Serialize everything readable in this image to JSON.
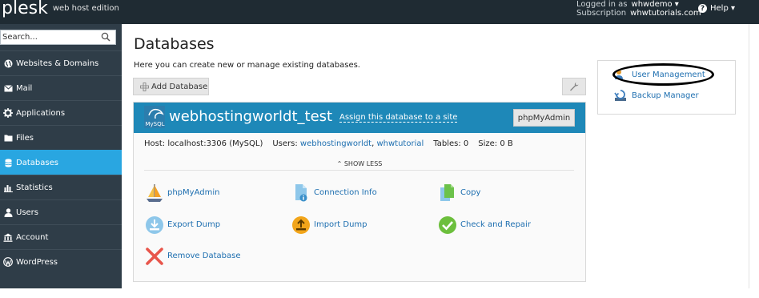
{
  "brand": {
    "logo": "plesk",
    "edition": "web host edition"
  },
  "account": {
    "logged_in_label": "Logged in as",
    "user": "whwdemo ▾",
    "subscription_label": "Subscription",
    "subscription": "whwtutorials.com"
  },
  "help": {
    "label": "Help ▾"
  },
  "search": {
    "placeholder": "Search..."
  },
  "nav": [
    {
      "label": "Websites & Domains",
      "icon": "globe-icon"
    },
    {
      "label": "Mail",
      "icon": "mail-icon"
    },
    {
      "label": "Applications",
      "icon": "gear-icon"
    },
    {
      "label": "Files",
      "icon": "folder-icon"
    },
    {
      "label": "Databases",
      "icon": "database-icon",
      "active": true
    },
    {
      "label": "Statistics",
      "icon": "bar-chart-icon"
    },
    {
      "label": "Users",
      "icon": "user-icon"
    },
    {
      "label": "Account",
      "icon": "account-icon"
    },
    {
      "label": "WordPress",
      "icon": "wordpress-icon"
    }
  ],
  "page": {
    "title": "Databases",
    "description": "Here you can create new or manage existing databases.",
    "add_button": "Add Database"
  },
  "database": {
    "logo_text": "MySQL",
    "name": "webhostingworldt_test",
    "assign_link": "Assign this database to a site",
    "phpmyadmin_button": "phpMyAdmin",
    "host_label": "Host: localhost:3306 (MySQL)",
    "users_label": "Users:",
    "user1": "webhostingworldt",
    "user_sep": ",",
    "user2": "whwtutorial",
    "tables": "Tables: 0",
    "size": "Size: 0 B",
    "show_less": "⌃ SHOW LESS",
    "actions": [
      {
        "label": "phpMyAdmin",
        "icon": "phpmyadmin-icon"
      },
      {
        "label": "Connection Info",
        "icon": "connection-info-icon"
      },
      {
        "label": "Copy",
        "icon": "copy-icon"
      },
      {
        "label": "Export Dump",
        "icon": "export-icon"
      },
      {
        "label": "Import Dump",
        "icon": "import-icon"
      },
      {
        "label": "Check and Repair",
        "icon": "check-icon"
      },
      {
        "label": "Remove Database",
        "icon": "remove-icon"
      }
    ]
  },
  "side_panel": {
    "user_management": "User Management",
    "backup_manager": "Backup Manager"
  },
  "colors": {
    "topbar": "#1f2b33",
    "sidebar": "#2f3d48",
    "active": "#29a6e1",
    "db_header": "#1e88b8",
    "link": "#1e6fb0"
  }
}
